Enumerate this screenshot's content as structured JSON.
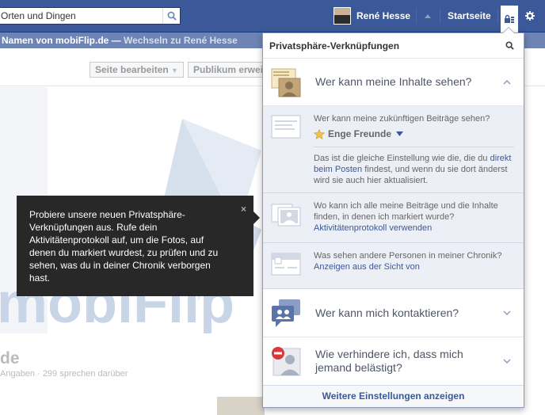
{
  "topbar": {
    "search_value": "Orten und Dingen",
    "profile_name": "René Hesse",
    "home_label": "Startseite"
  },
  "subbar": {
    "text": "Namen von mobiFlip.de — ",
    "switch_link": "Wechseln zu René Hesse"
  },
  "page": {
    "edit_button": "Seite bearbeiten",
    "audience_button": "Publikum erwei",
    "cover_text": "mobiFlip",
    "title": "de",
    "stats": "Angaben · 299 sprechen darüber"
  },
  "tooltip": {
    "text": "Probiere unsere neuen Privatsphäre-Verknüpfungen aus. Rufe dein Aktivitätenprotokoll auf, um die Fotos, auf denen du markiert wurdest, zu prüfen und zu sehen, was du in deiner Chronik verborgen hast.",
    "close": "×"
  },
  "panel": {
    "title": "Privatsphäre-Verknüpfungen",
    "section_content": "Wer kann meine Inhalte sehen?",
    "future_posts_question": "Wer kann meine zukünftigen Beiträge sehen?",
    "audience_value": "Enge Freunde",
    "explanation_pre": "Das ist die gleiche Einstellung wie die, die du ",
    "explanation_link": "direkt beim Posten",
    "explanation_post": " findest, und wenn du sie dort änderst wird sie auch hier aktualisiert.",
    "tagged_question": "Wo kann ich alle meine Beiträge und die Inhalte finden, in denen ich markiert wurde?",
    "activity_link": "Aktivitätenprotokoll verwenden",
    "timeline_question": "Was sehen andere Personen in meiner Chronik?",
    "view_as_link": "Anzeigen aus der Sicht von",
    "section_contact": "Wer kann mich kontaktieren?",
    "section_block": "Wie verhindere ich, dass mich jemand belästigt?",
    "more_settings": "Weitere Einstellungen anzeigen"
  },
  "colors": {
    "brand": "#3b5998",
    "subbar": "#6d84b4",
    "panel_sub_bg": "#eceff5"
  }
}
